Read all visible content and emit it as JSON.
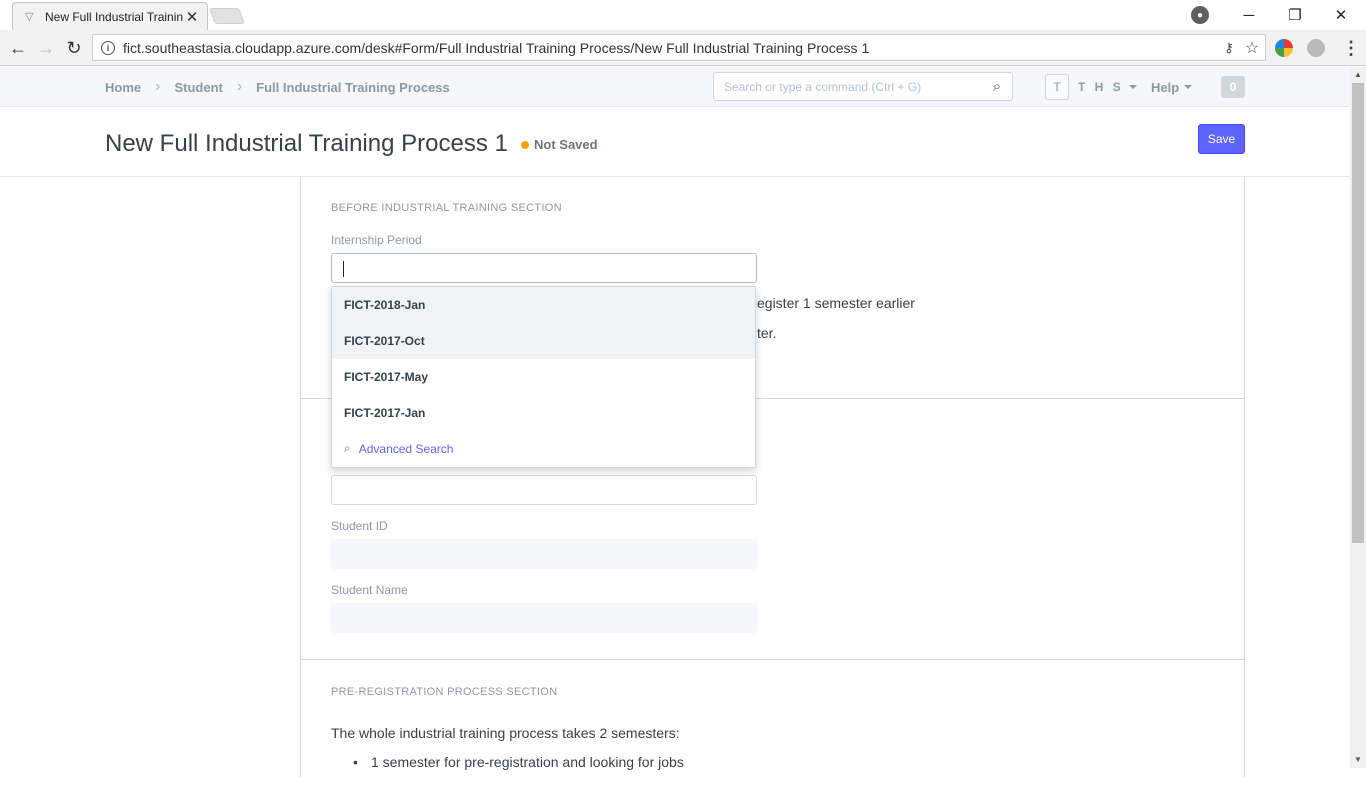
{
  "browser": {
    "tab_title": "New Full Industrial Trainin",
    "url": "fict.southeastasia.cloudapp.azure.com/desk#Form/Full Industrial Training Process/New Full Industrial Training Process 1"
  },
  "navbar": {
    "breadcrumbs": [
      "Home",
      "Student",
      "Full Industrial Training Process"
    ],
    "search_placeholder": "Search or type a command (Ctrl + G)",
    "user_initial": "T",
    "user_name": "T H S",
    "help_label": "Help",
    "notification_count": "0"
  },
  "page": {
    "title": "New Full Industrial Training Process 1",
    "status": "Not Saved",
    "save_label": "Save"
  },
  "form": {
    "section1_title": "BEFORE INDUSTRIAL TRAINING SECTION",
    "internship_label": "Internship Period",
    "internship_value": "",
    "partial_text_1": "egister 1 semester earlier",
    "partial_text_2": "ter.",
    "student_id_label": "Student ID",
    "student_name_label": "Student Name",
    "section2_title": "PRE-REGISTRATION PROCESS SECTION",
    "section2_intro": "The whole industrial training process takes 2 semesters:",
    "section2_bullet1": "1 semester for pre-registration and looking for jobs"
  },
  "dropdown": {
    "options": [
      "FICT-2018-Jan",
      "FICT-2017-Oct",
      "FICT-2017-May",
      "FICT-2017-Jan"
    ],
    "advanced_search": "Advanced Search"
  }
}
